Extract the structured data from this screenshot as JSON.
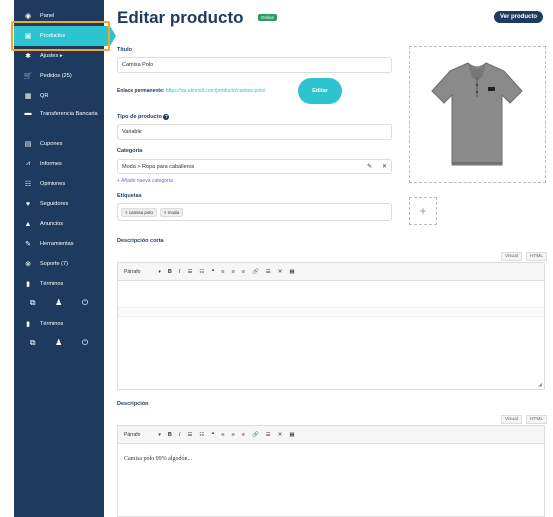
{
  "sidebar": {
    "items": [
      {
        "label": "Panel",
        "icon": "dashboard-icon",
        "glyph": "◉"
      },
      {
        "label": "Productos",
        "icon": "box-icon",
        "glyph": "▣"
      },
      {
        "label": "Ajustes",
        "icon": "gear-icon",
        "glyph": "✱",
        "suffix": "▸"
      },
      {
        "label": "Pedidos (25)",
        "icon": "cart-icon",
        "glyph": "🛒"
      },
      {
        "label": "QR",
        "icon": "qr-icon",
        "glyph": "▦"
      },
      {
        "label": "Transferencia Bancaria",
        "icon": "bank-icon",
        "glyph": "▬"
      },
      {
        "label": "Cupones",
        "icon": "gift-icon",
        "glyph": "▤"
      },
      {
        "label": "Informes",
        "icon": "chart-icon",
        "glyph": "⩘"
      },
      {
        "label": "Opiniones",
        "icon": "comments-icon",
        "glyph": "☷"
      },
      {
        "label": "Seguidores",
        "icon": "heart-icon",
        "glyph": "♥"
      },
      {
        "label": "Anuncios",
        "icon": "bell-icon",
        "glyph": "▲"
      },
      {
        "label": "Herramientas",
        "icon": "wrench-icon",
        "glyph": "✎"
      },
      {
        "label": "Soporte (7)",
        "icon": "support-icon",
        "glyph": "⊗"
      },
      {
        "label": "Términos",
        "icon": "document-icon",
        "glyph": "▮"
      }
    ],
    "footer_label": "Términos",
    "footer_glyphs": {
      "external": "⧉",
      "user": "♟",
      "power": "⏻"
    }
  },
  "header": {
    "title": "Editar producto",
    "badge": "Online",
    "view_button": "Ver producto"
  },
  "form": {
    "title_label": "Título",
    "title_value": "Camisa Polo",
    "permalink_label": "Enlace permanente:",
    "permalink_url": "https://qa.ekmodi.com/producto/camisa-polo/",
    "edit_button": "Editar",
    "type_label": "Tipo de producto",
    "type_help": "?",
    "type_value": "Variable",
    "category_label": "Categoría",
    "category_value": "Moda > Ropa para caballeros",
    "category_edit_icon": "✎",
    "category_remove_icon": "✕",
    "add_category": "+ Añadir nueva categoría",
    "tags_label": "Etiquetas",
    "tags": [
      "× camisa polo",
      "× moda"
    ],
    "add_image": "+"
  },
  "short_description": {
    "label": "Descripción corta",
    "tabs": [
      "Visual",
      "HTML"
    ],
    "format": "Párrafo",
    "toolbar": [
      "B",
      "I",
      "☰",
      "☷",
      "❝",
      "≡",
      "≡",
      "≡",
      "🔗",
      "☰",
      "✕",
      "▦"
    ],
    "content": ""
  },
  "description": {
    "label": "Descripción",
    "tabs": [
      "Visual",
      "HTML"
    ],
    "format": "Párrafo",
    "toolbar": [
      "B",
      "I",
      "☰",
      "☷",
      "❝",
      "≡",
      "≡",
      "≡",
      "🔗",
      "☰",
      "✕",
      "▦"
    ],
    "content": "Camisa polo 99% algodón..."
  },
  "colors": {
    "sidebar": "#1e3a5f",
    "active": "#2ec4cf",
    "highlight": "#f5a623",
    "badge": "#2e9a5c",
    "tag_link": "#7a5ccf"
  }
}
